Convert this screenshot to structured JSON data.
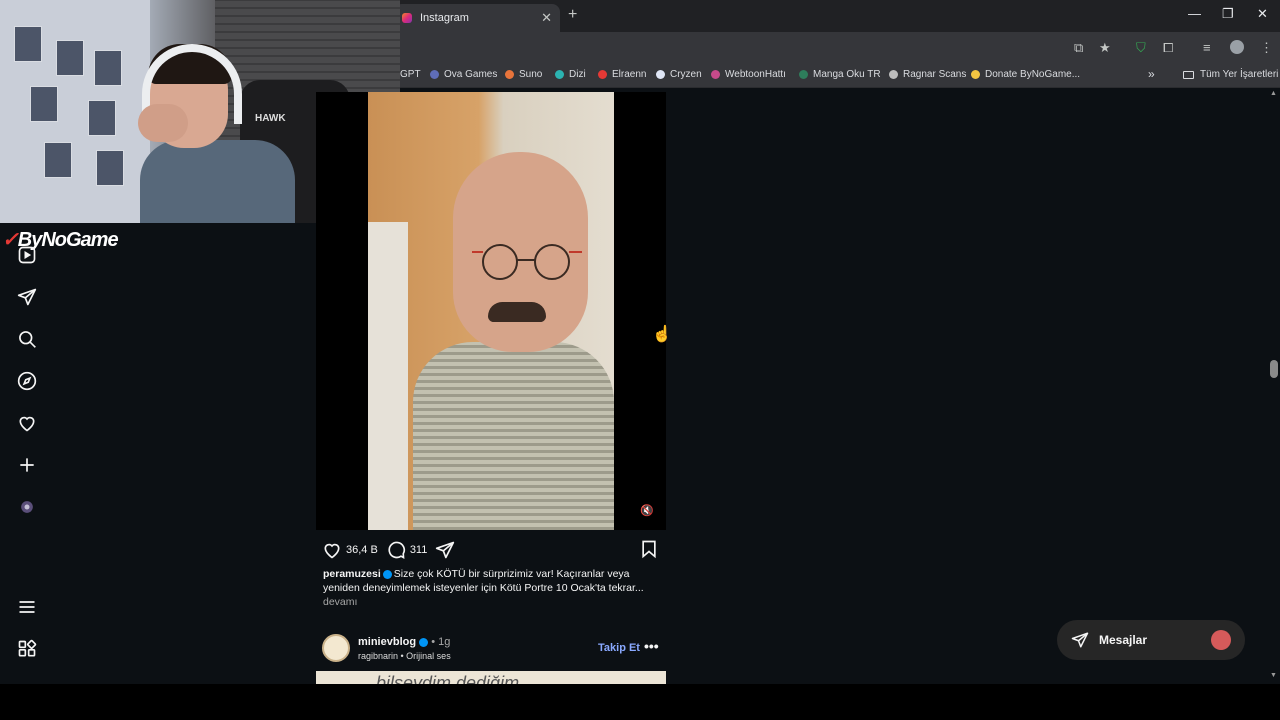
{
  "browser": {
    "tab_title": "Instagram",
    "tab_close": "✕",
    "new_tab": "+",
    "window_controls": [
      "—",
      "❐",
      "✕"
    ],
    "bookmarks": [
      {
        "label": "GPT",
        "color": "#35363a"
      },
      {
        "label": "Ova Games",
        "color": "#5f6db8"
      },
      {
        "label": "Suno",
        "color": "#e8743b"
      },
      {
        "label": "Dizi",
        "color": "#2bb3b1"
      },
      {
        "label": "Elraenn",
        "color": "#e53935"
      },
      {
        "label": "Cryzen",
        "color": "#dfe6f5"
      },
      {
        "label": "WebtoonHattı",
        "color": "#c64a8a"
      },
      {
        "label": "Manga Oku TR",
        "color": "#2e7d5b"
      },
      {
        "label": "Ragnar Scans",
        "color": "#bdbdbd"
      },
      {
        "label": "Donate ByNoGame...",
        "color": "#f4c542"
      }
    ],
    "bookmarks_overflow": "»",
    "all_bookmarks": "Tüm Yer İşaretleri"
  },
  "overlay": {
    "brand_mark": "✓",
    "brand_text": "ByNoGame",
    "chair_label": "HAWK"
  },
  "post": {
    "likes": "36,4 B",
    "comments": "311",
    "username": "peramuzesi",
    "caption": "Size çok KÖTÜ bir sürprizimiz var! Kaçıranlar veya yeniden deneyimlemek isteyenler için Kötü Portre 10 Ocak'ta tekrar...",
    "more": "devamı",
    "muted_icon": "🔇"
  },
  "post2": {
    "username": "minievblog",
    "age": "• 1g",
    "subtitle": "ragibnarin • Orijinal ses",
    "follow": "Takip Et",
    "more": "•••",
    "media_text": "bilseydim dediğim"
  },
  "messages": {
    "label": "Mesajlar"
  }
}
